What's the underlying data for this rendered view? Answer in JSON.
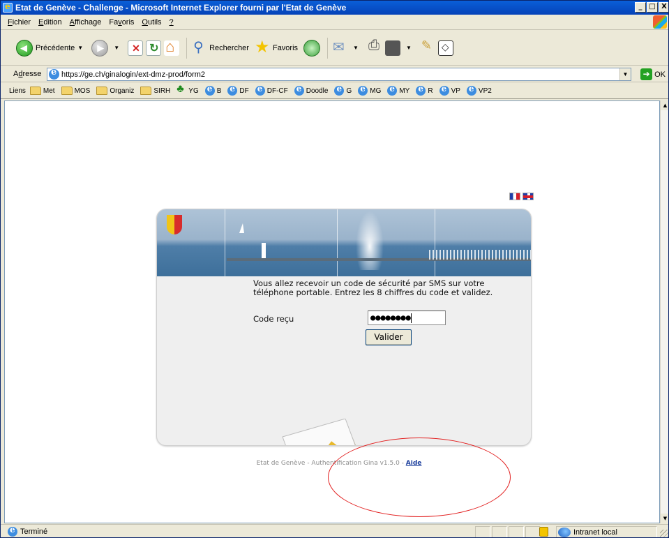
{
  "window": {
    "title": "Etat de Genève - Challenge - Microsoft Internet Explorer fourni par l'Etat de Genève",
    "controls": [
      "_",
      "□",
      "X"
    ]
  },
  "menu": [
    {
      "prefix": "",
      "u": "F",
      "rest": "ichier"
    },
    {
      "prefix": "",
      "u": "E",
      "rest": "dition"
    },
    {
      "prefix": "",
      "u": "A",
      "rest": "ffichage"
    },
    {
      "prefix": "Fa",
      "u": "v",
      "rest": "oris"
    },
    {
      "prefix": "",
      "u": "O",
      "rest": "utils"
    },
    {
      "prefix": "",
      "u": "?",
      "rest": ""
    }
  ],
  "toolbar": {
    "back_label": "Précédente",
    "search_label": "Rechercher",
    "favorites_label": "Favoris"
  },
  "address": {
    "label_prefix": "A",
    "label_u": "d",
    "label_rest": "resse",
    "url": "https://ge.ch/ginalogin/ext-dmz-prod/form2",
    "go_label": "OK"
  },
  "links": {
    "label": "Liens",
    "items": [
      {
        "label": "Met",
        "icon": "folder-icon"
      },
      {
        "label": "MOS",
        "icon": "folder-icon"
      },
      {
        "label": "Organiz",
        "icon": "folder-icon"
      },
      {
        "label": "SIRH",
        "icon": "folder-icon"
      },
      {
        "label": "YG",
        "icon": "tree-icon"
      },
      {
        "label": "B",
        "icon": "ie-page-icon"
      },
      {
        "label": "DF",
        "icon": "ie-page-icon"
      },
      {
        "label": "DF-CF",
        "icon": "ie-page-icon"
      },
      {
        "label": "Doodle",
        "icon": "ie-page-icon"
      },
      {
        "label": "G",
        "icon": "ie-page-icon"
      },
      {
        "label": "MG",
        "icon": "ie-page-icon"
      },
      {
        "label": "MY",
        "icon": "ie-page-icon"
      },
      {
        "label": "R",
        "icon": "ie-page-icon"
      },
      {
        "label": "VP",
        "icon": "ie-page-icon"
      },
      {
        "label": "VP2",
        "icon": "ie-page-icon"
      }
    ]
  },
  "page": {
    "instructions": "Vous allez recevoir un code de sécurité par SMS sur votre téléphone portable. Entrez les 8 chiffres du code et validez.",
    "code_label": "Code reçu",
    "code_value": "●●●●●●●●",
    "validate_label": "Valider",
    "footer_text": "Etat de Genève - Authentification Gina v1.5.0 - ",
    "help_link": "Aide"
  },
  "status": {
    "text": "Terminé",
    "zone": "Intranet local"
  },
  "colors": {
    "titlebar": "#0542b8",
    "annotation": "#e21f1f",
    "help_link": "#1a3d9c"
  }
}
